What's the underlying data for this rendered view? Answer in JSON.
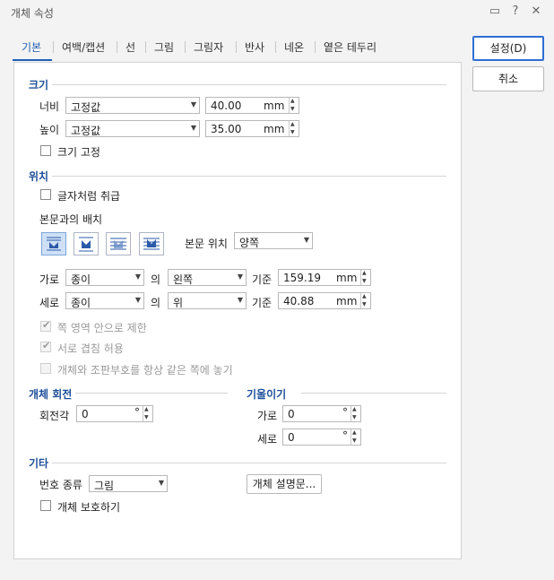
{
  "window": {
    "title": "개체 속성",
    "icons": [
      "chat-icon",
      "help-icon",
      "close-icon"
    ]
  },
  "tabs": [
    "기본",
    "여백/캡션",
    "선",
    "그림",
    "그림자",
    "반사",
    "네온",
    "옅은 테두리"
  ],
  "buttons": {
    "ok": "설정(D)",
    "cancel": "취소"
  },
  "size": {
    "title": "크기",
    "width_label": "너비",
    "width_mode": "고정값",
    "width_value": "40.00",
    "width_unit": "mm",
    "height_label": "높이",
    "height_mode": "고정값",
    "height_value": "35.00",
    "height_unit": "mm",
    "lock_label": "크기 고정"
  },
  "position": {
    "title": "위치",
    "treat_as_char": "글자처럼 취급",
    "layout_label": "본문과의 배치",
    "body_pos_label": "본문 위치",
    "body_pos_value": "양쪽",
    "horiz_label": "가로",
    "horiz_ref": "종이",
    "of1": "의",
    "horiz_align": "왼쪽",
    "base1": "기준",
    "horiz_value": "159.19",
    "horiz_unit": "mm",
    "vert_label": "세로",
    "vert_ref": "종이",
    "of2": "의",
    "vert_align": "위",
    "base2": "기준",
    "vert_value": "40.88",
    "vert_unit": "mm",
    "limit_area": "쪽 영역 안으로 제한",
    "allow_overlap": "서로 겹침 허용",
    "same_page": "개체와 조판부호를 항상 같은 쪽에 놓기"
  },
  "rotation": {
    "title": "개체 회전",
    "angle_label": "회전각",
    "angle_value": "0",
    "unit": "°"
  },
  "tilt": {
    "title": "기울이기",
    "x_label": "가로",
    "x_value": "0",
    "y_label": "세로",
    "y_value": "0",
    "unit": "°"
  },
  "etc": {
    "title": "기타",
    "number_type_label": "번호 종류",
    "number_type_value": "그림",
    "description_button": "개체 설명문...",
    "protect_label": "개체 보호하기"
  }
}
